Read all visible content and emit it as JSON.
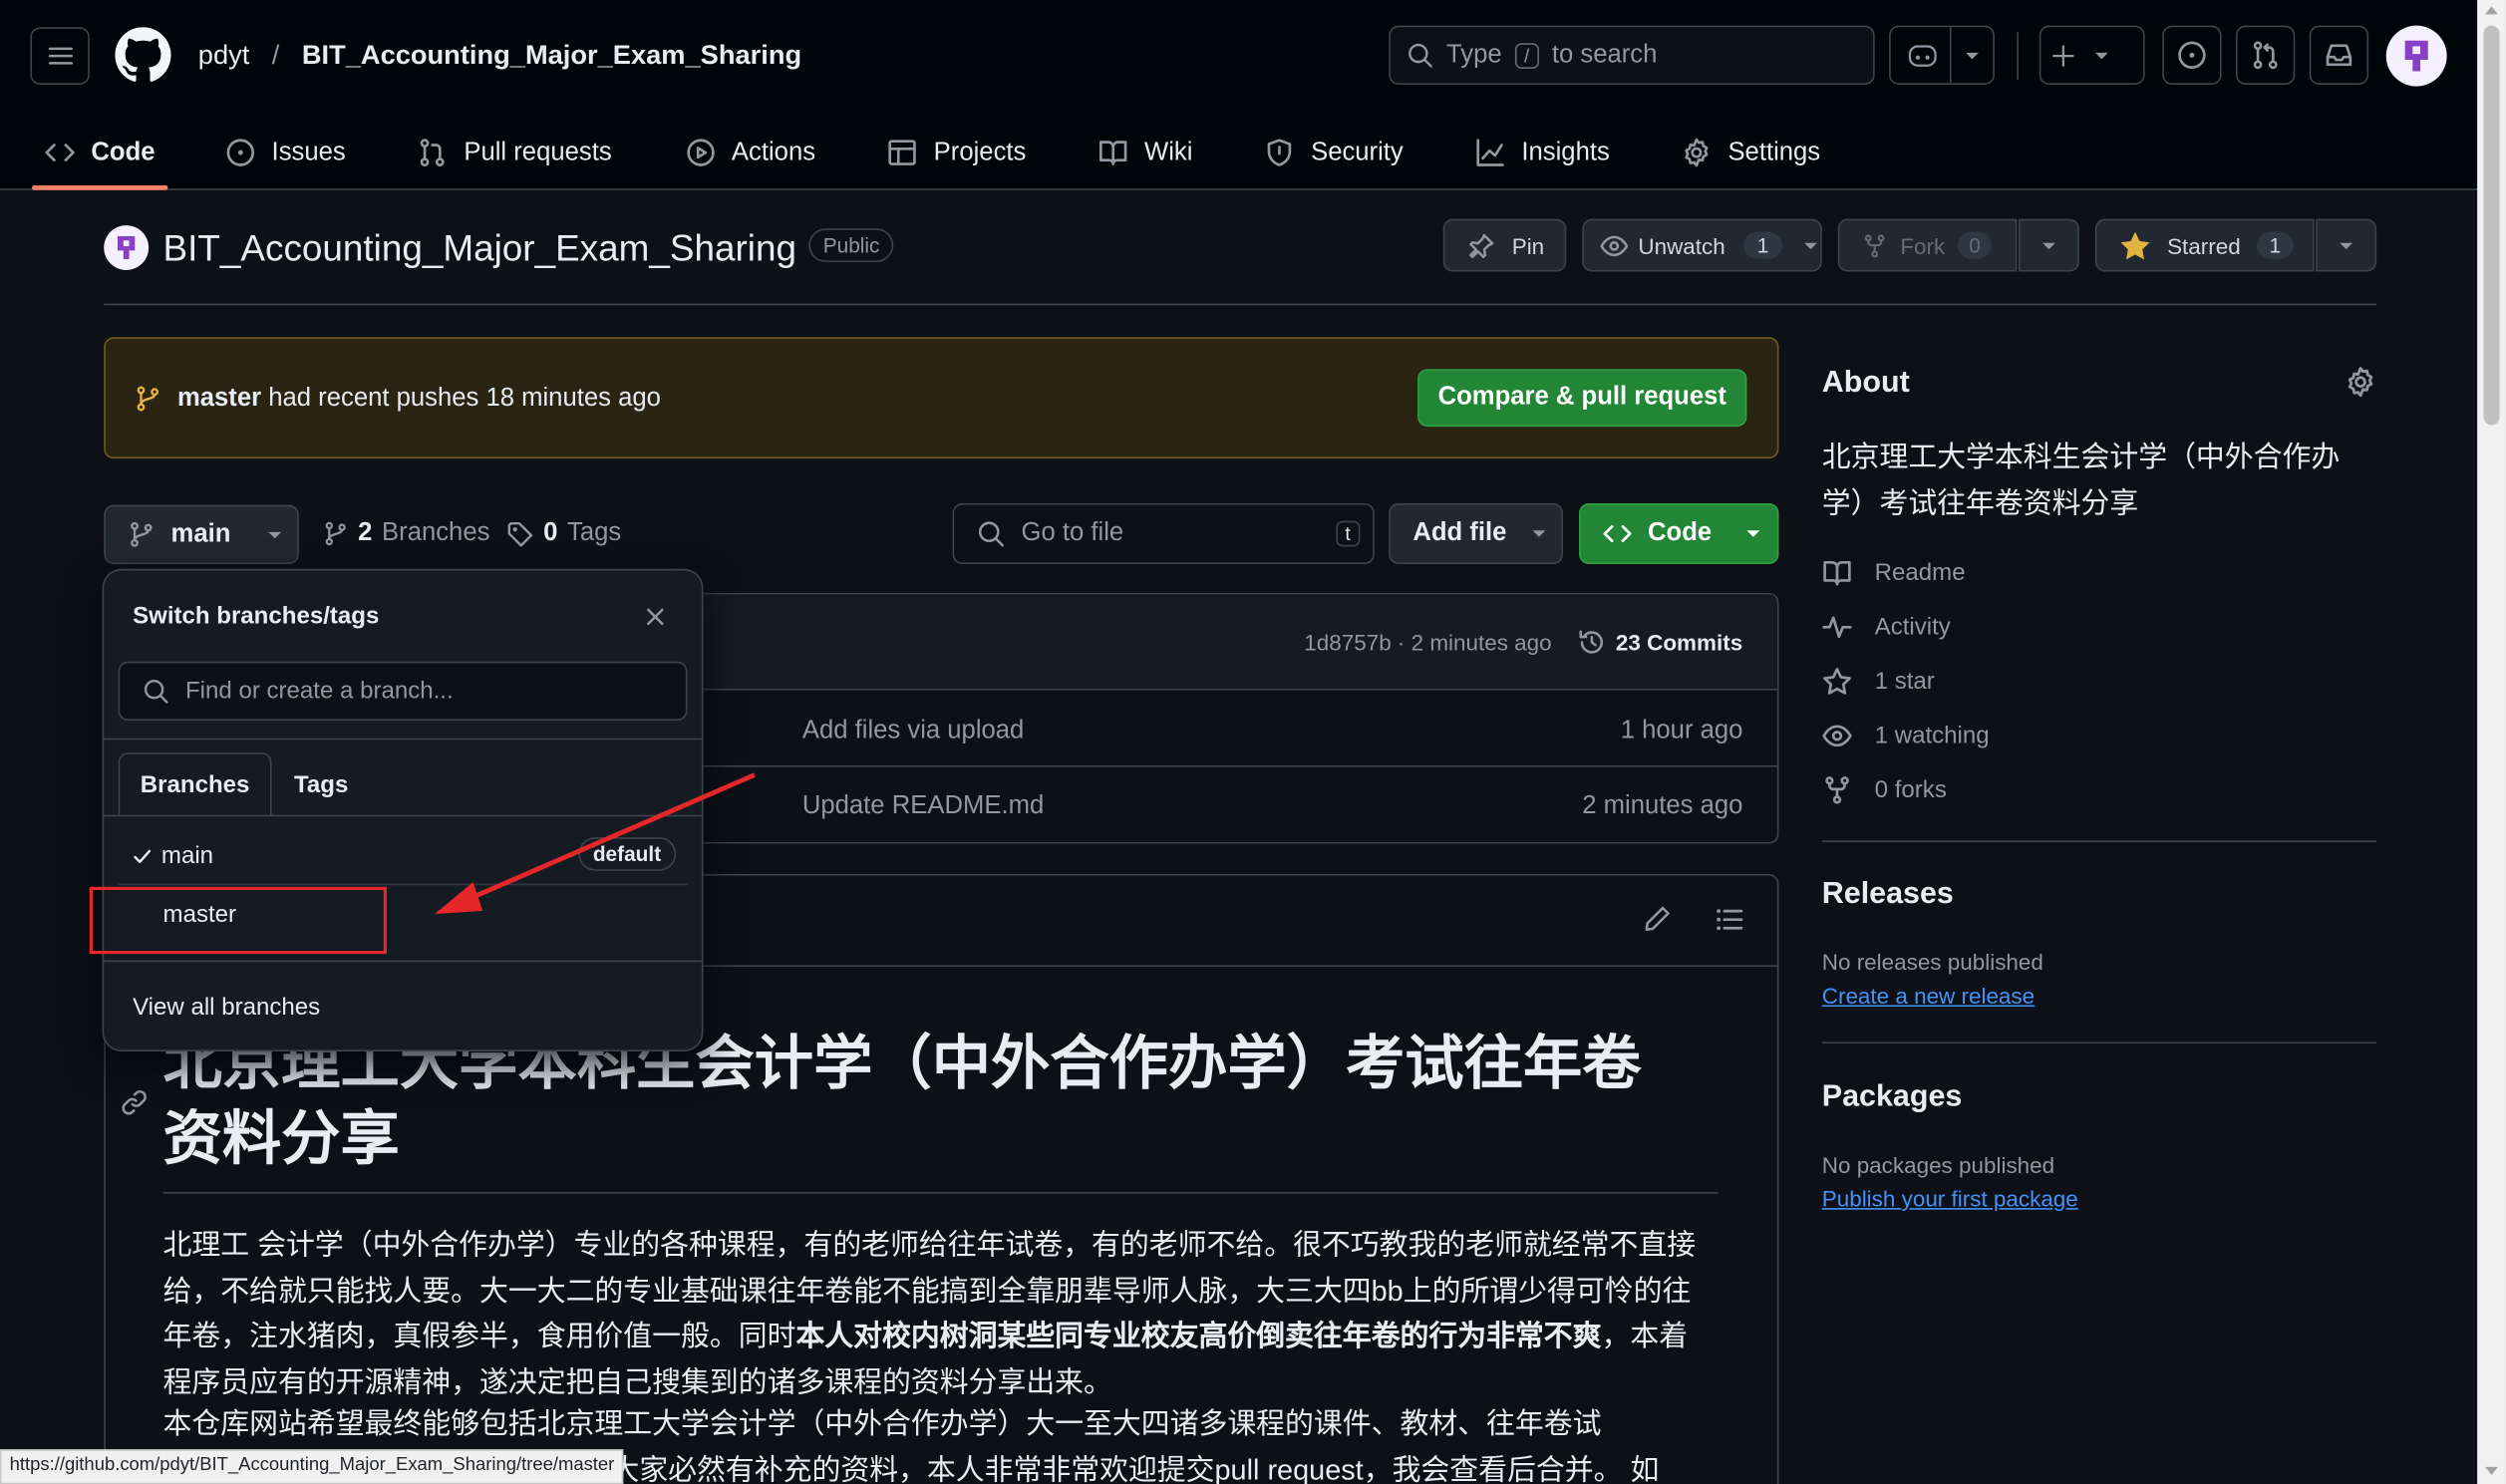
{
  "header": {
    "owner": "pdyt",
    "slash": "/",
    "repo": "BIT_Accounting_Major_Exam_Sharing",
    "search_prefix": "Type",
    "search_key": "/",
    "search_suffix": "to search"
  },
  "nav": {
    "tabs": [
      {
        "label": "Code",
        "icon": "code-icon"
      },
      {
        "label": "Issues",
        "icon": "issue-icon"
      },
      {
        "label": "Pull requests",
        "icon": "pull-request-icon"
      },
      {
        "label": "Actions",
        "icon": "play-icon"
      },
      {
        "label": "Projects",
        "icon": "table-icon"
      },
      {
        "label": "Wiki",
        "icon": "book-icon"
      },
      {
        "label": "Security",
        "icon": "shield-icon"
      },
      {
        "label": "Insights",
        "icon": "graph-icon"
      },
      {
        "label": "Settings",
        "icon": "gear-icon"
      }
    ],
    "active_color": "#f78166"
  },
  "repo_header": {
    "title": "BIT_Accounting_Major_Exam_Sharing",
    "visibility": "Public",
    "pin": "Pin",
    "unwatch": "Unwatch",
    "watch_count": "1",
    "fork": "Fork",
    "fork_count": "0",
    "starred": "Starred",
    "star_count": "1"
  },
  "banner": {
    "branch": "master",
    "text": "had recent pushes 18 minutes ago",
    "button": "Compare & pull request"
  },
  "toolbar": {
    "branch": "main",
    "branches_count": "2",
    "branches_label": "Branches",
    "tags_count": "0",
    "tags_label": "Tags",
    "goto_placeholder": "Go to file",
    "goto_key": "t",
    "add_file": "Add file",
    "code": "Code"
  },
  "commit_bar": {
    "sha_time": "1d8757b · 2 minutes ago",
    "commits": "23 Commits"
  },
  "files": [
    {
      "message": "Add files via upload",
      "time": "1 hour ago"
    },
    {
      "message": "Update README.md",
      "time": "2 minutes ago"
    }
  ],
  "dropdown": {
    "title": "Switch branches/tags",
    "placeholder": "Find or create a branch...",
    "tab_branches": "Branches",
    "tab_tags": "Tags",
    "items": [
      {
        "name": "main",
        "checked": true,
        "badge": "default"
      },
      {
        "name": "master",
        "checked": false,
        "badge": ""
      }
    ],
    "view_all": "View all branches"
  },
  "readme": {
    "title_line1": "北京理工大学本科生会计学（中外合作办学）考试往年卷",
    "title_line2": "资料分享",
    "p1_a": "北理工 会计学（中外合作办学）专业的各种课程，有的老师给往年试卷，有的老师不给。很不巧教我的老师就经常不直接给，不给就只能找人要。大一大二的专业基础课往年卷能不能搞到全靠朋辈导师人脉，大三大四bb上的所谓少得可怜的往年卷，注水猪肉，真假参半，食用价值一般。同时",
    "p1_b": "本人对校内树洞某些同专业校友高价倒卖往年卷的行为非常不爽",
    "p1_c": "，本着程序员应有的开源精神，遂决定把自己搜集到的诸多课程的资料分享出来。",
    "p2": "本仓库网站希望最终能够包括北京理工大学会计学（中外合作办学）大一至大四诸多课程的课件、教材、往年卷试",
    "p3": "大家必然有补充的资料，本人非常非常欢迎提交pull request，我会查看后合并。 如"
  },
  "about": {
    "heading": "About",
    "description": "北京理工大学本科生会计学（中外合作办学）考试往年卷资料分享",
    "readme": "Readme",
    "activity": "Activity",
    "stars": "1 star",
    "watching": "1 watching",
    "forks": "0 forks"
  },
  "releases": {
    "heading": "Releases",
    "none": "No releases published",
    "link": "Create a new release"
  },
  "packages": {
    "heading": "Packages",
    "none": "No packages published",
    "link": "Publish your first package"
  },
  "status_url": "https://github.com/pdyt/BIT_Accounting_Major_Exam_Sharing/tree/master",
  "colors": {
    "accent_green": "#238636",
    "link_blue": "#4493f8",
    "annotation_red": "#e5272a",
    "star_yellow": "#e3b341",
    "banner_bg": "#2b2413",
    "banner_border": "#6e5b1b"
  }
}
